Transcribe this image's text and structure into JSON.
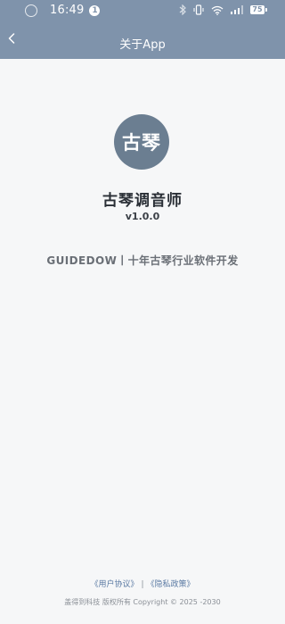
{
  "status_bar": {
    "time": "16:49",
    "notification_count": "1",
    "battery_level": "75"
  },
  "nav": {
    "title": "关于App"
  },
  "app": {
    "logo_text": "古琴",
    "name": "古琴调音师",
    "version": "v1.0.0",
    "tagline": "GUIDEDOW丨十年古琴行业软件开发"
  },
  "footer": {
    "user_agreement": "《用户协议》",
    "separator": "|",
    "privacy_policy": "《隐私政策》",
    "copyright": "盖得到科技 版权所有 Copyright © 2025 -2030"
  },
  "colors": {
    "header_bg": "#7f93ab",
    "logo_bg": "#6b7e91",
    "page_bg": "#f6f7f8",
    "link": "#5b7aa3"
  }
}
